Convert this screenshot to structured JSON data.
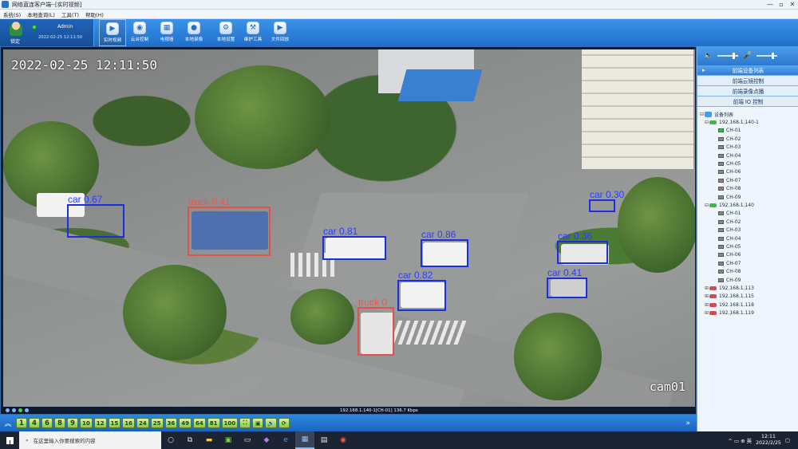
{
  "window": {
    "title": "网络直连客户端--[实时视频]",
    "controls": [
      "—",
      "▫",
      "✕"
    ]
  },
  "menu": [
    "系统(S)",
    "本地查询(L)",
    "工具(T)",
    "帮助(H)"
  ],
  "user_panel": {
    "lock_label": "锁定",
    "user": "Admin",
    "datetime": "2022-02-25 12:11:50"
  },
  "toolbar": [
    {
      "label": "实时视频",
      "icon": "video-icon",
      "glyph": "▶",
      "active": true
    },
    {
      "label": "云台控制",
      "icon": "ptz-icon",
      "glyph": "◉",
      "active": false
    },
    {
      "label": "电视墙",
      "icon": "tv-wall-icon",
      "glyph": "▦",
      "active": false
    },
    {
      "label": "本地录像",
      "icon": "record-icon",
      "glyph": "●",
      "active": false
    },
    {
      "label": "本地设置",
      "icon": "settings-icon",
      "glyph": "⚙",
      "active": false
    },
    {
      "label": "维护工具",
      "icon": "tools-icon",
      "glyph": "⚒",
      "active": false
    },
    {
      "label": "文件回放",
      "icon": "playback-icon",
      "glyph": "▶",
      "active": false
    }
  ],
  "video": {
    "timestamp": "2022-02-25 12:11:50",
    "camera_label": "cam01",
    "stream_info": "192.168.1.140-1[CH-01]   136.7 Kbps",
    "detections": [
      {
        "class": "car",
        "label": "car 0.67"
      },
      {
        "class": "truck",
        "label": "truck 0.41"
      },
      {
        "class": "car",
        "label": "car 0.81"
      },
      {
        "class": "car",
        "label": "car 0.86"
      },
      {
        "class": "car",
        "label": "car 0.82"
      },
      {
        "class": "truck",
        "label": "truck 0"
      },
      {
        "class": "car",
        "label": "car 0.30"
      },
      {
        "class": "car",
        "label": "car 0.36"
      },
      {
        "class": "car",
        "label": "car 0.41"
      }
    ]
  },
  "split_buttons": [
    "1",
    "4",
    "6",
    "8",
    "9",
    "10",
    "12",
    "15",
    "16",
    "24",
    "25",
    "36",
    "49",
    "64",
    "81",
    "100"
  ],
  "split_icons": [
    "⛶",
    "▣",
    "🔊",
    "⟳"
  ],
  "right_panel": {
    "sections": [
      "前端设备列表",
      "前端云镜控制",
      "前端录像点播",
      "前端 IO 控制"
    ],
    "tree_root": "设备列表",
    "devices": [
      {
        "ip": "192.168.1.140-1",
        "online": true,
        "expanded": true,
        "channels": [
          "CH-01",
          "CH-02",
          "CH-03",
          "CH-04",
          "CH-05",
          "CH-06",
          "CH-07",
          "CH-08",
          "CH-09"
        ]
      },
      {
        "ip": "192.168.1.140",
        "online": true,
        "expanded": true,
        "channels": [
          "CH-01",
          "CH-02",
          "CH-03",
          "CH-04",
          "CH-05",
          "CH-06",
          "CH-07",
          "CH-08",
          "CH-09"
        ]
      },
      {
        "ip": "192.168.1.113",
        "online": false,
        "expanded": false,
        "channels": []
      },
      {
        "ip": "192.168.1.115",
        "online": false,
        "expanded": false,
        "channels": []
      },
      {
        "ip": "192.168.1.118",
        "online": false,
        "expanded": false,
        "channels": []
      },
      {
        "ip": "192.168.1.119",
        "online": false,
        "expanded": false,
        "channels": []
      }
    ]
  },
  "taskbar": {
    "search_placeholder": "在这里输入你要搜索的内容",
    "tray_text": "^ ▭ ⊕ 英",
    "time": "12:11",
    "date": "2022/2/25"
  }
}
